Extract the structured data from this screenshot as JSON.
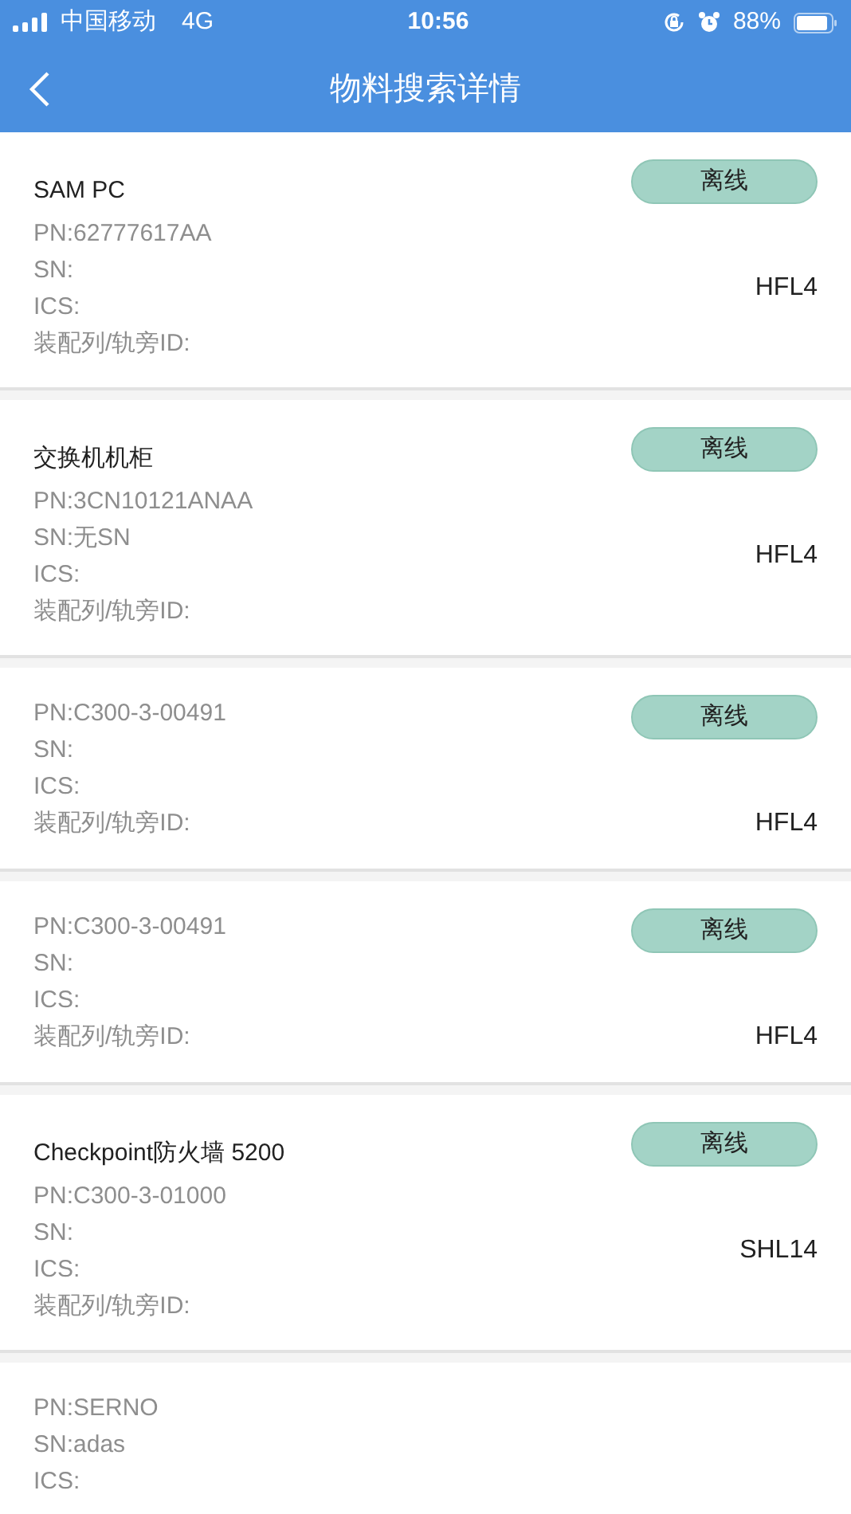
{
  "status_bar": {
    "carrier": "中国移动",
    "network": "4G",
    "time": "10:56",
    "battery": "88%"
  },
  "header": {
    "back": true,
    "title": "物料搜索详情"
  },
  "items": [
    {
      "title": "SAM PC",
      "pn": "PN:62777617AA",
      "sn": "SN:",
      "ics": "ICS:",
      "track_id": "装配列/轨旁ID:",
      "status": {
        "label": "离线",
        "kind": "offline"
      },
      "location": "HFL4"
    },
    {
      "title": "交换机机柜",
      "pn": "PN:3CN10121ANAA",
      "sn": "SN:无SN",
      "ics": "ICS:",
      "track_id": "装配列/轨旁ID:",
      "status": {
        "label": "离线",
        "kind": "offline"
      },
      "location": "HFL4"
    },
    {
      "pn": "PN:C300-3-00491",
      "sn": "SN:",
      "ics": "ICS:",
      "track_id": "装配列/轨旁ID:",
      "status": {
        "label": "离线",
        "kind": "offline"
      },
      "location": "HFL4"
    },
    {
      "pn": "PN:C300-3-00491",
      "sn": "SN:",
      "ics": "ICS:",
      "track_id": "装配列/轨旁ID:",
      "status": {
        "label": "离线",
        "kind": "offline"
      },
      "location": "HFL4"
    },
    {
      "title": "Checkpoint防火墙 5200",
      "pn": "PN:C300-3-01000",
      "sn": "SN:",
      "ics": "ICS:",
      "track_id": "装配列/轨旁ID:",
      "status": {
        "label": "离线",
        "kind": "offline"
      },
      "location": "SHL14"
    },
    {
      "pn": "PN:SERNO",
      "sn": "SN:adas",
      "ics": "ICS:"
    }
  ]
}
